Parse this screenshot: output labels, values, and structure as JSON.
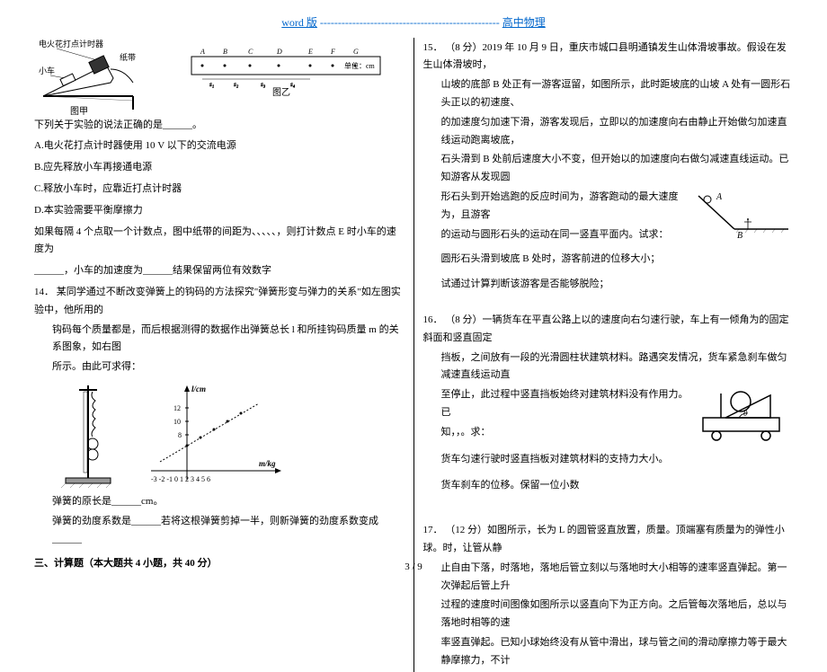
{
  "header": {
    "word": "word 版",
    "dashes": "--------------------------------------------------",
    "subject": "高中物理"
  },
  "left": {
    "diag_label_device": "电火花打点计时器",
    "diag_label_cart": "小车",
    "diag_label_tape": "纸带",
    "diag_caption_left": "图甲",
    "diag_caption_right": "图乙",
    "diag_unit": "单位：cm",
    "intro": "下列关于实验的说法正确的是______。",
    "optA": "A.电火花打点计时器使用 10 V 以下的交流电源",
    "optB": "B.应先释放小车再接通电源",
    "optC": "C.释放小车时，应靠近打点计时器",
    "optD": "D.本实验需要平衡摩擦力",
    "line_interval": "如果每隔 4 个点取一个计数点，图中纸带的间距为、、、、、，则打计数点 E 时小车的速度为",
    "line_interval2": "______，小车的加速度为______结果保留两位有效数字",
    "q14_num": "14．",
    "q14_text1": "某同学通过不断改变弹簧上的钩码的方法探究\"弹簧形变与弹力的关系\"如左图实验中，他所用的",
    "q14_text2": "钩码每个质量都是，而后根据测得的数据作出弹簧总长 l 和所挂钩码质量 m 的关系图象，如右图",
    "q14_text3": "所示。由此可求得：",
    "graph_y": "l/cm",
    "graph_x": "m/kg",
    "graph_yticks": "12, 10, 8",
    "graph_xticks": "-3 -2 -1 0 1 2 3 4 5 6",
    "q14_ans1": "弹簧的原长是______cm。",
    "q14_ans2": "弹簧的劲度系数是______若将这根弹簧剪掉一半，则新弹簧的劲度系数变成______",
    "section3": "三、计算题（本大题共 4 小题，共 40 分）"
  },
  "right": {
    "q15_num": "15．",
    "q15_line1": "（8 分）2019 年 10 月 9 日，重庆市城口县明通镇发生山体滑坡事故。假设在发生山体滑坡时，",
    "q15_line2": "山坡的底部 B 处正有一游客逗留，如图所示，此时距坡底的山坡 A 处有一圆形石头正以的初速度、",
    "q15_line3": "的加速度匀加速下滑，游客发现后，立即以的加速度向右由静止开始做匀加速直线运动跑离坡底，",
    "q15_line4": "石头滑到 B 处前后速度大小不变，但开始以的加速度向右做匀减速直线运动。已知游客从发现圆",
    "q15_line5": "形石头到开始逃跑的反应时间为，游客跑动的最大速度为，且游客",
    "q15_line6": "的运动与圆形石头的运动在同一竖直平面内。试求：",
    "q15_line7": "圆形石头滑到坡底 B 处时，游客前进的位移大小；",
    "q15_line8": "试通过计算判断该游客是否能够脱险；",
    "q15_label_A": "A",
    "q15_label_B": "B",
    "q16_num": "16．",
    "q16_line1": "（8 分）一辆货车在平直公路上以的速度向右匀速行驶，车上有一倾角为的固定斜面和竖直固定",
    "q16_line2": "挡板，之间放有一段的光滑圆柱状建筑材料。路遇突发情况，货车紧急刹车做匀减速直线运动直",
    "q16_line3": "至停止，此过程中竖直挡板始终对建筑材料没有作用力。已",
    "q16_line4": "知，，。求：",
    "q16_line5": "货车匀速行驶时竖直挡板对建筑材料的支持力大小。",
    "q16_line6": "货车刹车的位移。保留一位小数",
    "q16_theta": "θ",
    "q17_num": "17．",
    "q17_line1": "（12 分）如图所示，长为 L 的圆管竖直放置，质量。顶端塞有质量为的弹性小球。时，让管从静",
    "q17_line2": "止自由下落，时落地，落地后管立刻以与落地时大小相等的速率竖直弹起。第一次弹起后管上升",
    "q17_line3": "过程的速度时间图像如图所示以竖直向下为正方向。之后管每次落地后，总以与落地时相等的速",
    "q17_line4": "率竖直弹起。已知小球始终没有从管中滑出，球与管之间的滑动摩擦力等于最大静摩擦力，不计"
  },
  "footer": {
    "page": "3 / 9"
  }
}
